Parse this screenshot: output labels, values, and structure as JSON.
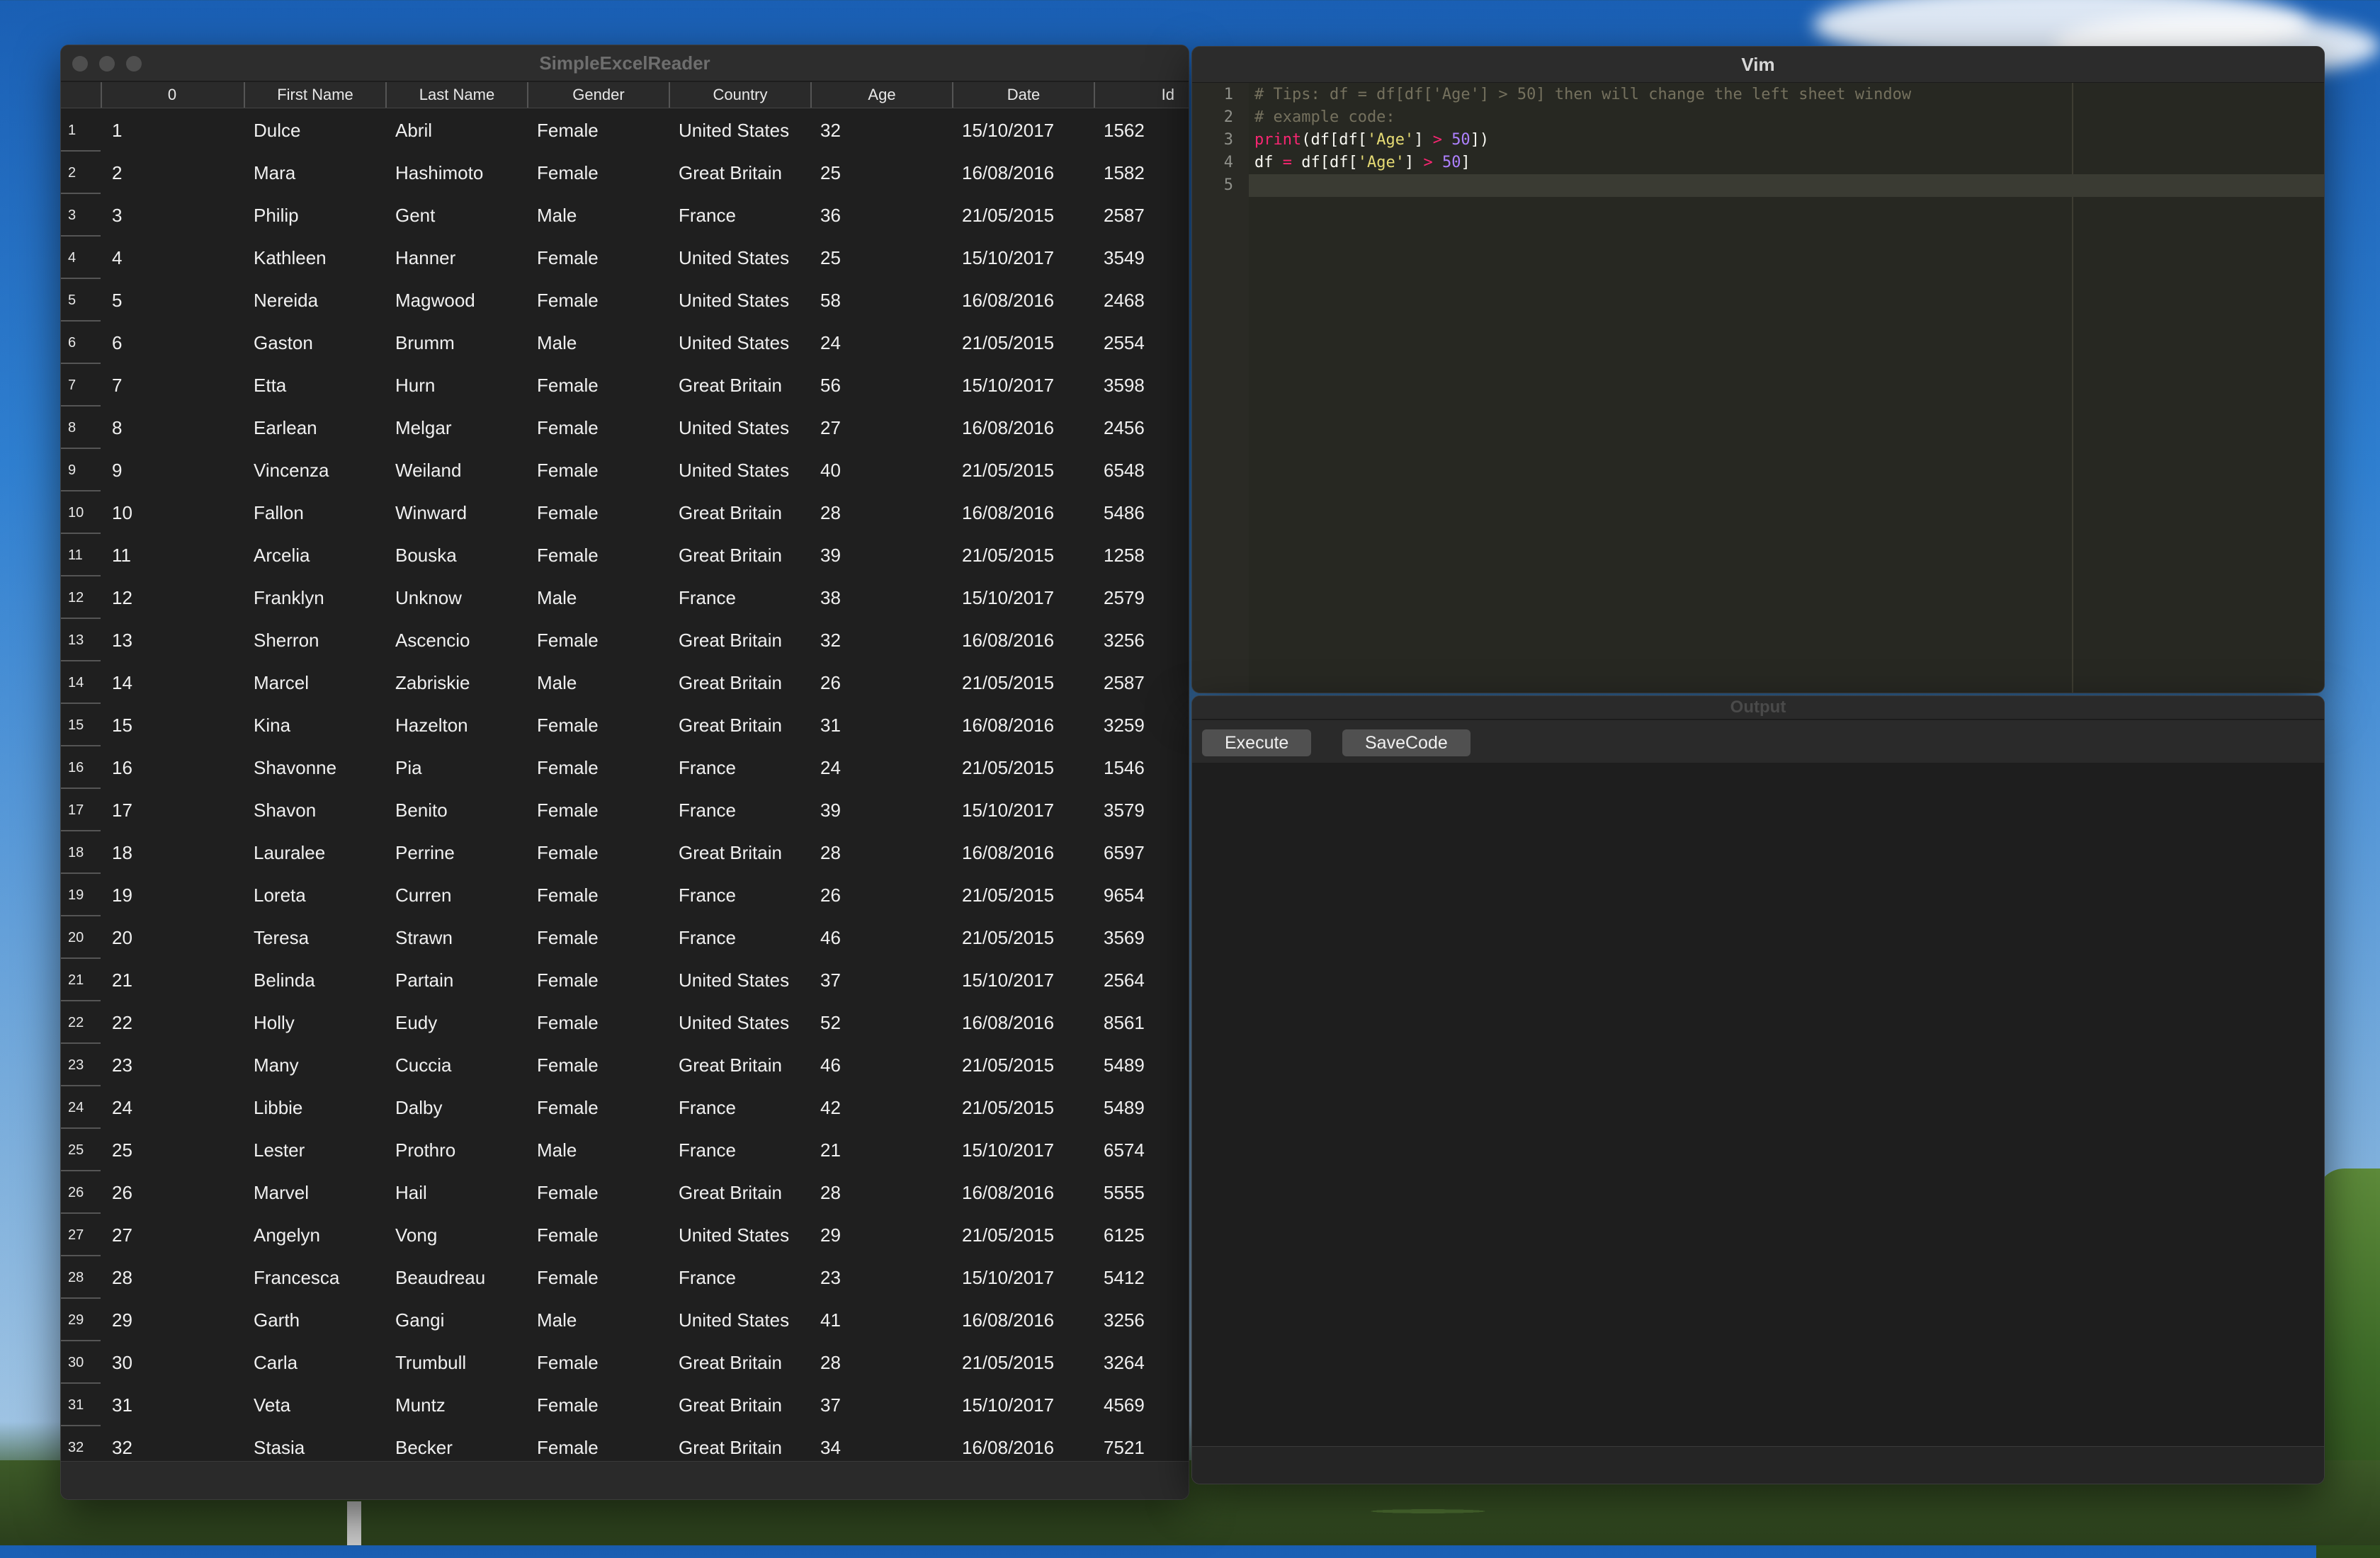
{
  "left_window": {
    "title": "SimpleExcelReader",
    "columns": [
      "0",
      "First Name",
      "Last Name",
      "Gender",
      "Country",
      "Age",
      "Date",
      "Id"
    ],
    "rows": [
      [
        "1",
        "1",
        "Dulce",
        "Abril",
        "Female",
        "United States",
        "32",
        "15/10/2017",
        "1562"
      ],
      [
        "2",
        "2",
        "Mara",
        "Hashimoto",
        "Female",
        "Great Britain",
        "25",
        "16/08/2016",
        "1582"
      ],
      [
        "3",
        "3",
        "Philip",
        "Gent",
        "Male",
        "France",
        "36",
        "21/05/2015",
        "2587"
      ],
      [
        "4",
        "4",
        "Kathleen",
        "Hanner",
        "Female",
        "United States",
        "25",
        "15/10/2017",
        "3549"
      ],
      [
        "5",
        "5",
        "Nereida",
        "Magwood",
        "Female",
        "United States",
        "58",
        "16/08/2016",
        "2468"
      ],
      [
        "6",
        "6",
        "Gaston",
        "Brumm",
        "Male",
        "United States",
        "24",
        "21/05/2015",
        "2554"
      ],
      [
        "7",
        "7",
        "Etta",
        "Hurn",
        "Female",
        "Great Britain",
        "56",
        "15/10/2017",
        "3598"
      ],
      [
        "8",
        "8",
        "Earlean",
        "Melgar",
        "Female",
        "United States",
        "27",
        "16/08/2016",
        "2456"
      ],
      [
        "9",
        "9",
        "Vincenza",
        "Weiland",
        "Female",
        "United States",
        "40",
        "21/05/2015",
        "6548"
      ],
      [
        "10",
        "10",
        "Fallon",
        "Winward",
        "Female",
        "Great Britain",
        "28",
        "16/08/2016",
        "5486"
      ],
      [
        "11",
        "11",
        "Arcelia",
        "Bouska",
        "Female",
        "Great Britain",
        "39",
        "21/05/2015",
        "1258"
      ],
      [
        "12",
        "12",
        "Franklyn",
        "Unknow",
        "Male",
        "France",
        "38",
        "15/10/2017",
        "2579"
      ],
      [
        "13",
        "13",
        "Sherron",
        "Ascencio",
        "Female",
        "Great Britain",
        "32",
        "16/08/2016",
        "3256"
      ],
      [
        "14",
        "14",
        "Marcel",
        "Zabriskie",
        "Male",
        "Great Britain",
        "26",
        "21/05/2015",
        "2587"
      ],
      [
        "15",
        "15",
        "Kina",
        "Hazelton",
        "Female",
        "Great Britain",
        "31",
        "16/08/2016",
        "3259"
      ],
      [
        "16",
        "16",
        "Shavonne",
        "Pia",
        "Female",
        "France",
        "24",
        "21/05/2015",
        "1546"
      ],
      [
        "17",
        "17",
        "Shavon",
        "Benito",
        "Female",
        "France",
        "39",
        "15/10/2017",
        "3579"
      ],
      [
        "18",
        "18",
        "Lauralee",
        "Perrine",
        "Female",
        "Great Britain",
        "28",
        "16/08/2016",
        "6597"
      ],
      [
        "19",
        "19",
        "Loreta",
        "Curren",
        "Female",
        "France",
        "26",
        "21/05/2015",
        "9654"
      ],
      [
        "20",
        "20",
        "Teresa",
        "Strawn",
        "Female",
        "France",
        "46",
        "21/05/2015",
        "3569"
      ],
      [
        "21",
        "21",
        "Belinda",
        "Partain",
        "Female",
        "United States",
        "37",
        "15/10/2017",
        "2564"
      ],
      [
        "22",
        "22",
        "Holly",
        "Eudy",
        "Female",
        "United States",
        "52",
        "16/08/2016",
        "8561"
      ],
      [
        "23",
        "23",
        "Many",
        "Cuccia",
        "Female",
        "Great Britain",
        "46",
        "21/05/2015",
        "5489"
      ],
      [
        "24",
        "24",
        "Libbie",
        "Dalby",
        "Female",
        "France",
        "42",
        "21/05/2015",
        "5489"
      ],
      [
        "25",
        "25",
        "Lester",
        "Prothro",
        "Male",
        "France",
        "21",
        "15/10/2017",
        "6574"
      ],
      [
        "26",
        "26",
        "Marvel",
        "Hail",
        "Female",
        "Great Britain",
        "28",
        "16/08/2016",
        "5555"
      ],
      [
        "27",
        "27",
        "Angelyn",
        "Vong",
        "Female",
        "United States",
        "29",
        "21/05/2015",
        "6125"
      ],
      [
        "28",
        "28",
        "Francesca",
        "Beaudreau",
        "Female",
        "France",
        "23",
        "15/10/2017",
        "5412"
      ],
      [
        "29",
        "29",
        "Garth",
        "Gangi",
        "Male",
        "United States",
        "41",
        "16/08/2016",
        "3256"
      ],
      [
        "30",
        "30",
        "Carla",
        "Trumbull",
        "Female",
        "Great Britain",
        "28",
        "21/05/2015",
        "3264"
      ],
      [
        "31",
        "31",
        "Veta",
        "Muntz",
        "Female",
        "Great Britain",
        "37",
        "15/10/2017",
        "4569"
      ],
      [
        "32",
        "32",
        "Stasia",
        "Becker",
        "Female",
        "Great Britain",
        "34",
        "16/08/2016",
        "7521"
      ]
    ]
  },
  "vim_window": {
    "title": "Vim",
    "line_numbers": [
      "1",
      "2",
      "3",
      "4",
      "5"
    ],
    "code_lines": [
      "# Tips: df = df[df['Age'] > 50] then will change the left sheet window",
      "# example code:",
      "print(df[df['Age'] > 50])",
      "df = df[df['Age'] > 50]",
      ""
    ]
  },
  "output_window": {
    "title": "Output",
    "execute_label": "Execute",
    "savecode_label": "SaveCode"
  }
}
